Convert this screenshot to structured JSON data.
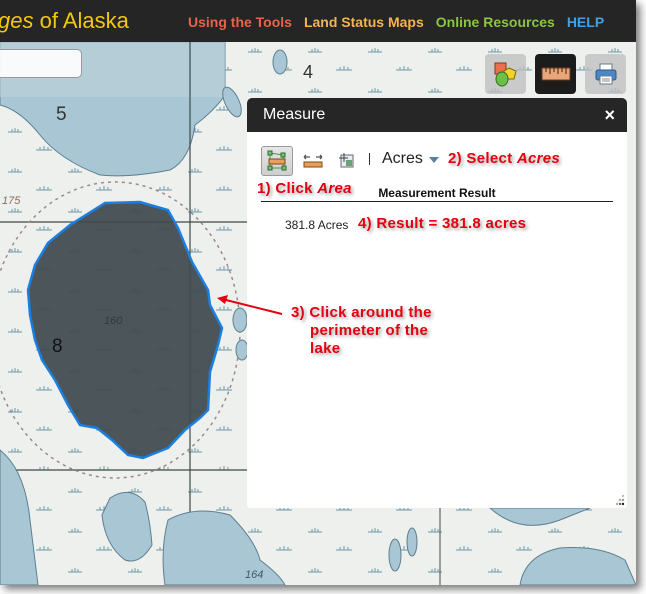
{
  "header": {
    "title_italic": "ges",
    "title_rest": " of Alaska",
    "nav": [
      {
        "label": "Using the Tools",
        "color": "#e8634a"
      },
      {
        "label": "Land Status Maps",
        "color": "#f4b54a"
      },
      {
        "label": "Online Resources",
        "color": "#8cc63f"
      },
      {
        "label": "HELP",
        "color": "#3fa1e6"
      }
    ]
  },
  "map": {
    "section_labels": [
      "5",
      "4",
      "8"
    ],
    "elevation_labels": [
      "175",
      "160",
      "164"
    ],
    "polygon_fill": "#3f4a4f",
    "polygon_stroke": "#1a7fe0"
  },
  "toolbar": {
    "buttons": [
      {
        "name": "layers",
        "icon": "shapes-icon"
      },
      {
        "name": "measure",
        "icon": "ruler-icon",
        "active": true
      },
      {
        "name": "print",
        "icon": "printer-icon"
      }
    ]
  },
  "measure": {
    "title": "Measure",
    "close": "×",
    "tools": [
      "area",
      "distance",
      "location"
    ],
    "active_tool": "area",
    "unit": "Acres",
    "result_header": "Measurement Result",
    "result_value": "381.8 Acres"
  },
  "annotations": {
    "step1_prefix": "1) Click ",
    "step1_em": "Area",
    "step2_prefix": "2) Select ",
    "step2_em": "Acres",
    "step3_line1": "3) Click around the",
    "step3_line2": "perimeter of the",
    "step3_line3": "lake",
    "step4": "4) Result = 381.8 acres"
  }
}
